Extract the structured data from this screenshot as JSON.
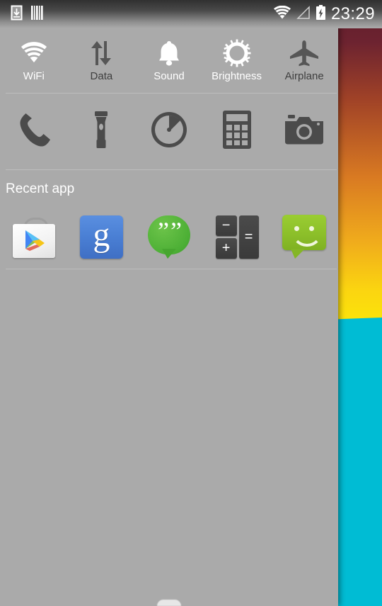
{
  "statusbar": {
    "time": "23:29",
    "left_icons": [
      {
        "name": "download-icon",
        "label": "Download"
      },
      {
        "name": "barcode-icon",
        "label": "Barcode"
      }
    ],
    "right_icons": [
      {
        "name": "wifi-icon",
        "label": "WiFi signal"
      },
      {
        "name": "cellular-signal-icon",
        "label": "No signal"
      },
      {
        "name": "battery-charging-icon",
        "label": "Battery charging"
      }
    ]
  },
  "toggles": [
    {
      "label": "WiFi",
      "icon": "wifi-icon",
      "state": "on"
    },
    {
      "label": "Data",
      "icon": "data-icon",
      "state": "off"
    },
    {
      "label": "Sound",
      "icon": "bell-icon",
      "state": "on"
    },
    {
      "label": "Brightness",
      "icon": "brightness-icon",
      "state": "on"
    },
    {
      "label": "Airplane",
      "icon": "airplane-icon",
      "state": "off"
    }
  ],
  "shortcuts": [
    {
      "label": "Phone",
      "icon": "phone-icon"
    },
    {
      "label": "Flashlight",
      "icon": "flashlight-icon"
    },
    {
      "label": "Clock",
      "icon": "clock-icon"
    },
    {
      "label": "Calculator",
      "icon": "calculator-icon"
    },
    {
      "label": "Camera",
      "icon": "camera-icon"
    }
  ],
  "recent": {
    "title": "Recent app",
    "apps": [
      {
        "label": "Play Store",
        "icon": "play-store-icon"
      },
      {
        "label": "Google",
        "icon": "google-icon",
        "glyph": "g"
      },
      {
        "label": "Hangouts",
        "icon": "hangouts-icon",
        "glyph": "”"
      },
      {
        "label": "Calculator",
        "icon": "calculator-app-icon",
        "keys": [
          "−",
          "+",
          "="
        ]
      },
      {
        "label": "Messaging",
        "icon": "messaging-icon"
      }
    ]
  },
  "colors": {
    "panel_bg": "#aaaaaa",
    "toggle_on": "#ffffff",
    "toggle_off": "#3f3f3f",
    "wallpaper_top": "#5e1c2b",
    "wallpaper_mid": "#fbe40a",
    "wallpaper_bottom": "#00bcd4"
  }
}
